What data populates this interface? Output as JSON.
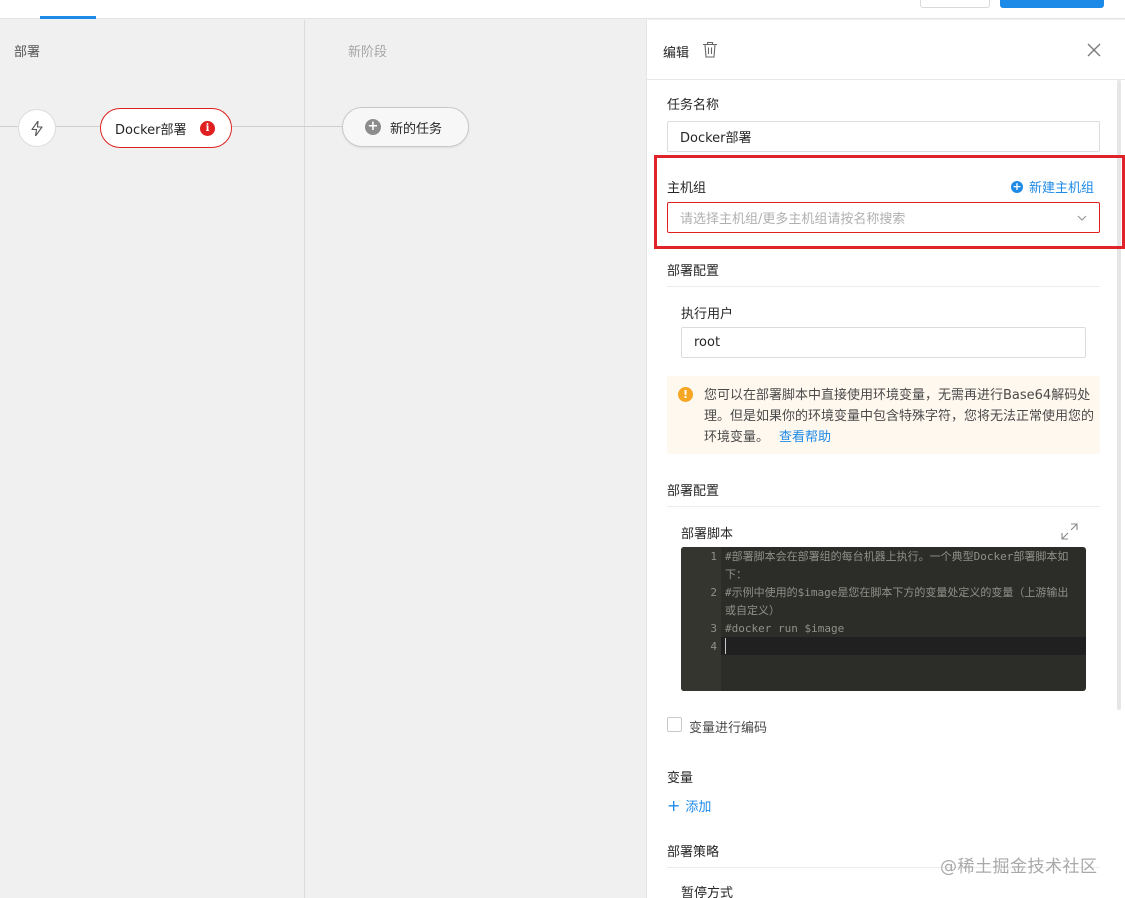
{
  "canvas": {
    "stages": [
      {
        "title": "部署"
      },
      {
        "title": "新阶段"
      }
    ],
    "task_node": {
      "label": "Docker部署",
      "error_badge": "i"
    },
    "new_task_node": {
      "label": "新的任务",
      "icon": "plus-circle-icon"
    },
    "trigger_icon": "lightning-icon"
  },
  "panel": {
    "title": "编辑",
    "task_name": {
      "label": "任务名称",
      "value": "Docker部署"
    },
    "host_group": {
      "label": "主机组",
      "new_link": "新建主机组",
      "placeholder": "请选择主机组/更多主机组请按名称搜索"
    },
    "deploy_config_1": {
      "title": "部署配置"
    },
    "exec_user": {
      "label": "执行用户",
      "value": "root"
    },
    "alert": {
      "icon": "!",
      "text": "您可以在部署脚本中直接使用环境变量，无需再进行Base64解码处理。但是如果你的环境变量中包含特殊字符，您将无法正常使用您的环境变量。",
      "link": "查看帮助"
    },
    "deploy_config_2": {
      "title": "部署配置"
    },
    "script": {
      "label": "部署脚本",
      "lines": [
        {
          "num": "1",
          "text": "#部署脚本会在部署组的每台机器上执行。一个典型Docker部署脚本如下："
        },
        {
          "num": "2",
          "text": "#示例中使用的$image是您在脚本下方的变量处定义的变量（上游输出或自定义）"
        },
        {
          "num": "3",
          "text": "#docker run $image"
        },
        {
          "num": "4",
          "text": ""
        }
      ]
    },
    "encode_vars": {
      "label": "变量进行编码",
      "checked": false
    },
    "variables": {
      "title": "变量",
      "add_label": "添加"
    },
    "strategy": {
      "title": "部署策略"
    },
    "pause_mode": {
      "label": "暂停方式"
    }
  },
  "watermark": "@稀土掘金技术社区",
  "colors": {
    "accent": "#1e8ae8",
    "error": "#e02020",
    "highlight": "#e0222b",
    "warning": "#f5a623",
    "editor_bg": "#2c2d29"
  }
}
